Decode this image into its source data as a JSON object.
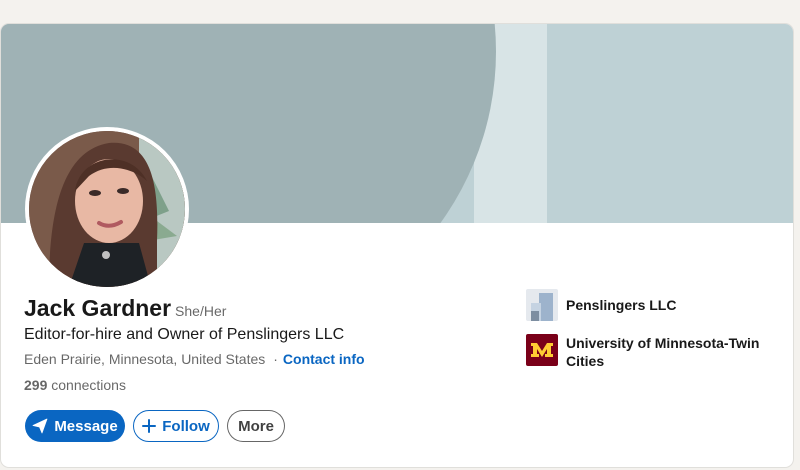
{
  "profile": {
    "name": "Jack Gardner",
    "pronouns": "She/Her",
    "headline": "Editor-for-hire and Owner of Penslingers LLC",
    "location": "Eden Prairie, Minnesota, United States",
    "separator": "·",
    "contact_label": "Contact info",
    "connections_count": "299",
    "connections_label": "connections"
  },
  "actions": {
    "message_label": "Message",
    "follow_label": "Follow",
    "more_label": "More"
  },
  "organizations": [
    {
      "name": "Penslingers LLC",
      "icon": "company-logo-icon"
    },
    {
      "name": "University of Minnesota-Twin Cities",
      "icon": "university-logo-icon"
    }
  ],
  "colors": {
    "accent": "#0a66c2",
    "banner_light": "#bed1d5",
    "banner_dark": "#9fb2b5",
    "university_maroon": "#7a0019",
    "university_gold": "#ffcc33"
  }
}
